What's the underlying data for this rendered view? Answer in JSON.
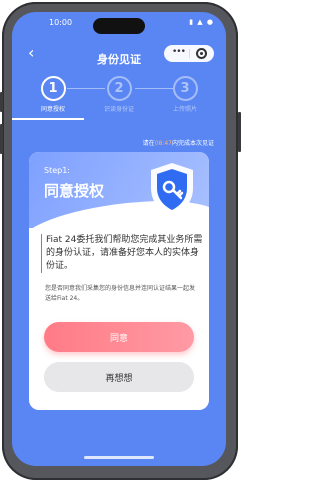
{
  "status_bar": {
    "time": "10:00",
    "icons": "▮ ▲ ●"
  },
  "nav": {
    "title": "身份见证",
    "back_icon": "chevron-left-icon",
    "more_icon": "more-dots-icon",
    "target_icon": "target-icon"
  },
  "steps": [
    {
      "number": "1",
      "label": "同意授权",
      "active": true
    },
    {
      "number": "2",
      "label": "识读身份证",
      "active": false
    },
    {
      "number": "3",
      "label": "上传照片",
      "active": false
    }
  ],
  "countdown": {
    "prefix": "请在",
    "time": "08:47",
    "suffix": "内完成本次见证"
  },
  "card": {
    "step_tag": "Step1:",
    "heading": "同意授权",
    "notice": "Fiat 24委托我们帮助您完成其业务所需的身份认证，请准备好您本人的实体身份证。",
    "consent": "您是否同意我们采集您的身份信息并连同认证结果一起发送给Fiat 24。",
    "agree_label": "同意",
    "rethink_label": "再想想"
  },
  "colors": {
    "background": "#5a86f3",
    "agree": "#ff7b86",
    "countdown_time": "#ffb36a"
  }
}
